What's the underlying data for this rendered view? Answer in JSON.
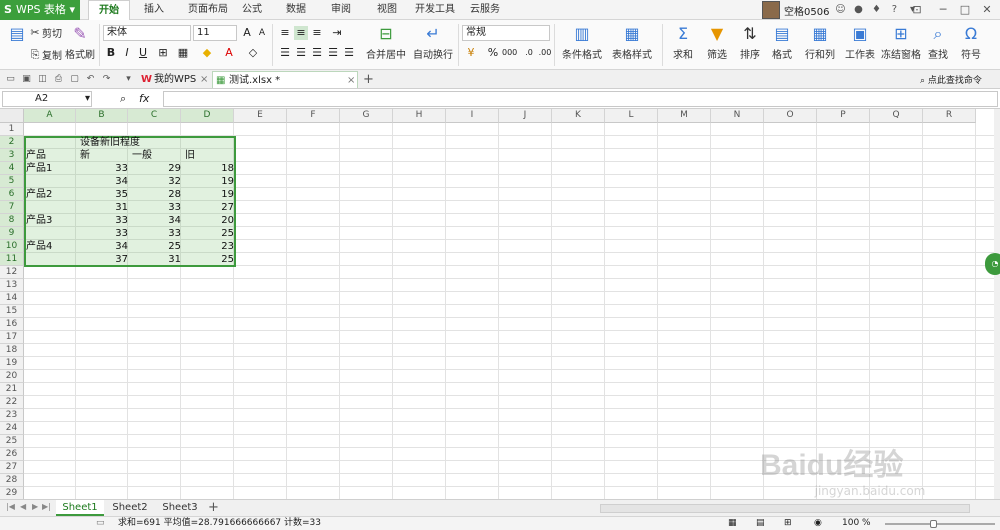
{
  "menubar": {
    "app_name": "WPS 表格",
    "tabs": [
      "开始",
      "插入",
      "页面布局",
      "公式",
      "数据",
      "审阅",
      "视图",
      "开发工具",
      "云服务"
    ],
    "active_tab": 0,
    "user": "空格0506"
  },
  "ribbon": {
    "cut": "剪切",
    "copy": "复制",
    "format_painter": "格式刷",
    "font_name": "宋体",
    "font_size": "11",
    "merge_center": "合并居中",
    "wrap_text": "自动换行",
    "number_format": "常规",
    "percent": "%",
    "cond_format": "条件格式",
    "table_style": "表格样式",
    "sum": "求和",
    "filter": "筛选",
    "sort": "排序",
    "format": "格式",
    "rows_cols": "行和列",
    "worksheet": "工作表",
    "freeze": "冻结窗格",
    "find": "查找",
    "symbol": "符号"
  },
  "docbar": {
    "tab1": "我的WPS",
    "tab2": "测试.xlsx *",
    "search": "点此查找命令"
  },
  "formula": {
    "namebox": "A2",
    "fx": "fx"
  },
  "columns": [
    "A",
    "B",
    "C",
    "D",
    "E",
    "F",
    "G",
    "H",
    "I",
    "J",
    "K",
    "L",
    "M",
    "N",
    "O",
    "P",
    "Q",
    "R"
  ],
  "rows": [
    "1",
    "2",
    "3",
    "4",
    "5",
    "6",
    "7",
    "8",
    "9",
    "10",
    "11",
    "12",
    "13",
    "14",
    "15",
    "16",
    "17",
    "18",
    "19",
    "20",
    "21",
    "22",
    "23",
    "24",
    "25",
    "26",
    "27",
    "28",
    "29"
  ],
  "cells": {
    "title": "设备新旧程度",
    "header": [
      "产品",
      "新",
      "一般",
      "旧"
    ],
    "data": [
      {
        "product": "产品1",
        "new": "33",
        "normal": "29",
        "old": "18"
      },
      {
        "product": "",
        "new": "34",
        "normal": "32",
        "old": "19"
      },
      {
        "product": "产品2",
        "new": "35",
        "normal": "28",
        "old": "19"
      },
      {
        "product": "",
        "new": "31",
        "normal": "33",
        "old": "27"
      },
      {
        "product": "产品3",
        "new": "33",
        "normal": "34",
        "old": "20"
      },
      {
        "product": "",
        "new": "33",
        "normal": "33",
        "old": "25"
      },
      {
        "product": "产品4",
        "new": "34",
        "normal": "25",
        "old": "23"
      },
      {
        "product": "",
        "new": "37",
        "normal": "31",
        "old": "25"
      }
    ]
  },
  "sheets": [
    "Sheet1",
    "Sheet2",
    "Sheet3"
  ],
  "active_sheet": 0,
  "status": {
    "summary": "求和=691   平均值=28.791666666667   计数=33",
    "zoom": "100 %"
  },
  "watermark": {
    "brand": "Baidu经验",
    "url": "jingyan.baidu.com"
  },
  "colors": {
    "accent": "#3d9a3d",
    "selection": "#d7ead3"
  }
}
